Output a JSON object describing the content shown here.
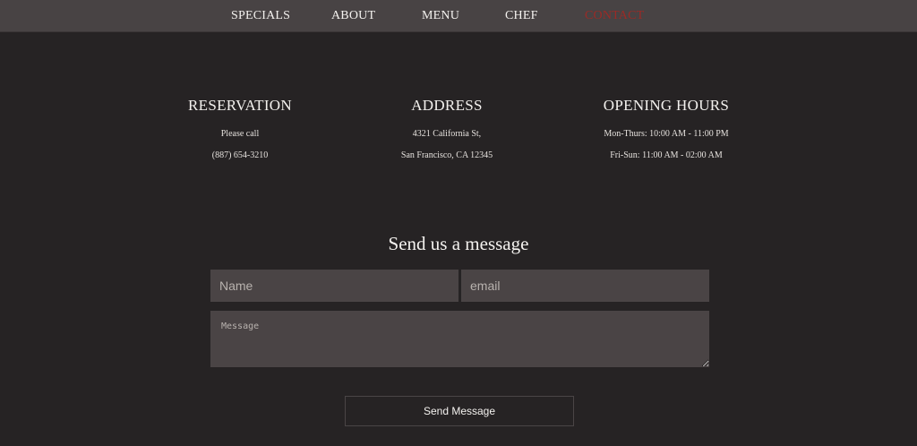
{
  "nav": {
    "items": [
      {
        "label": "SPECIALS"
      },
      {
        "label": "ABOUT"
      },
      {
        "label": "MENU"
      },
      {
        "label": "CHEF"
      },
      {
        "label": "CONTACT",
        "active": true
      }
    ],
    "active_color": "#9b2a26"
  },
  "info": {
    "reservation": {
      "title": "RESERVATION",
      "line1": "Please call",
      "line2": "(887) 654-3210"
    },
    "address": {
      "title": "ADDRESS",
      "line1": "4321 California St,",
      "line2": "San Francisco, CA 12345"
    },
    "hours": {
      "title": "OPENING HOURS",
      "line1": "Mon-Thurs: 10:00 AM - 11:00 PM",
      "line2": "Fri-Sun: 11:00 AM - 02:00 AM"
    }
  },
  "form": {
    "title": "Send us a message",
    "name_placeholder": "Name",
    "email_placeholder": "email",
    "message_placeholder": "Message",
    "submit_label": "Send Message"
  },
  "colors": {
    "background": "#262324",
    "nav_background": "#484344",
    "field_background": "#4a4445"
  }
}
